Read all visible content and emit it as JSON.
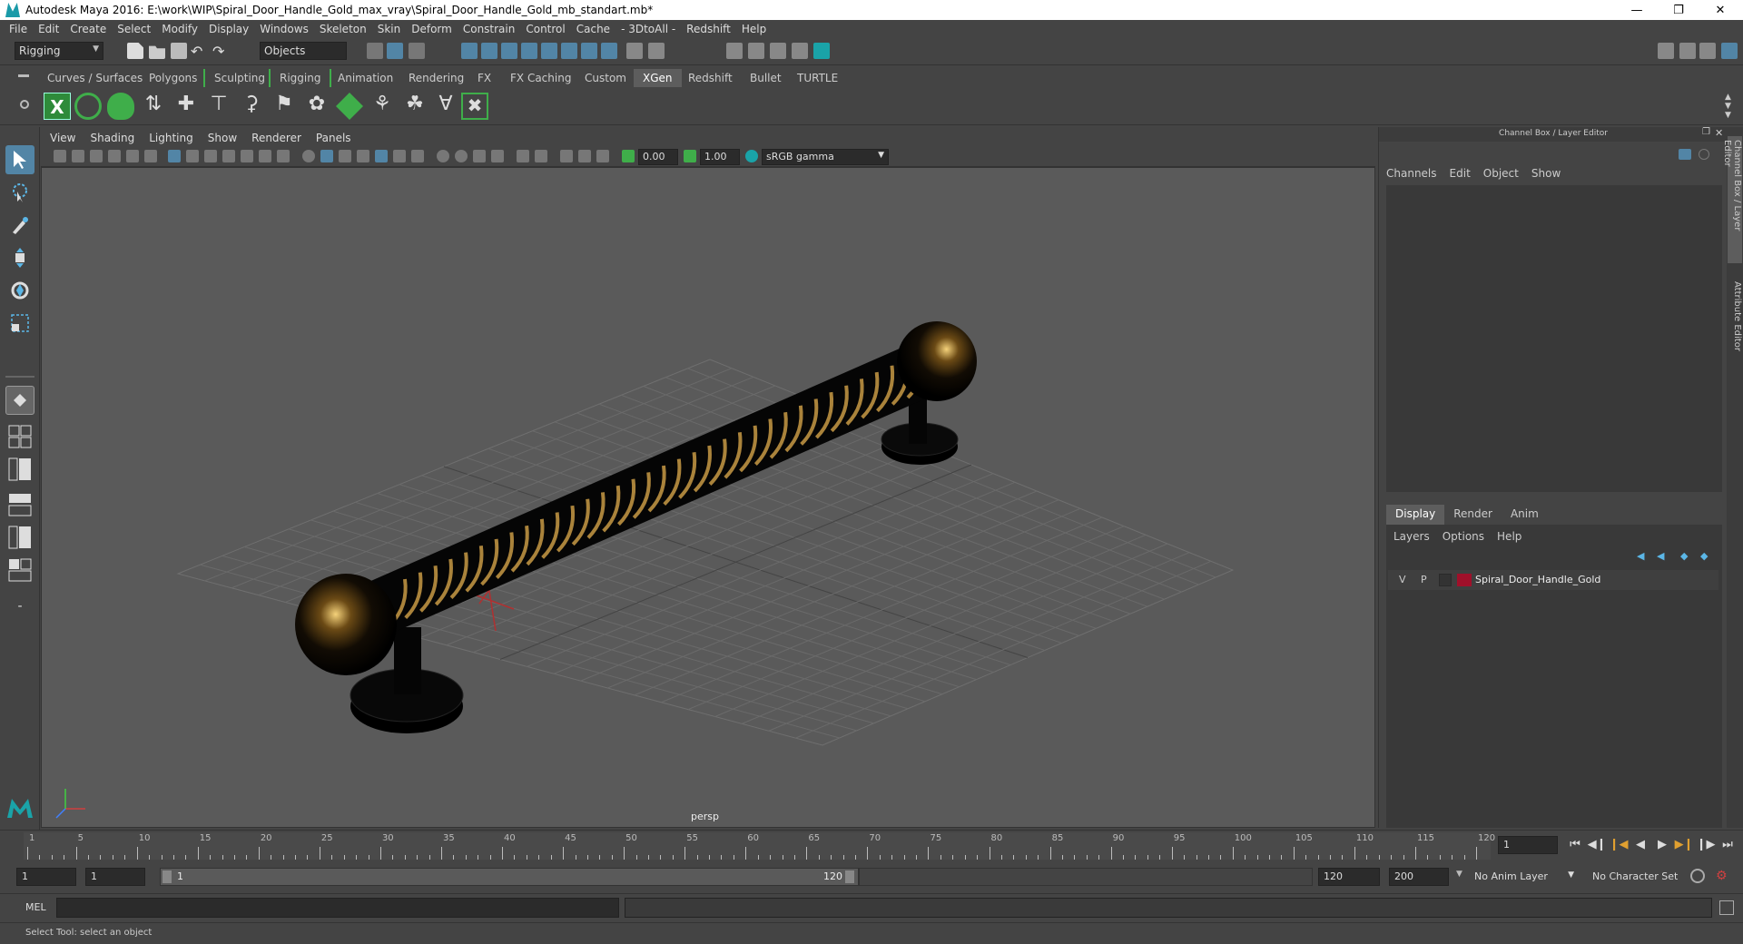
{
  "window": {
    "title": "Autodesk Maya 2016: E:\\work\\WIP\\Spiral_Door_Handle_Gold_max_vray\\Spiral_Door_Handle_Gold_mb_standart.mb*"
  },
  "menubar": [
    "File",
    "Edit",
    "Create",
    "Select",
    "Modify",
    "Display",
    "Windows",
    "Skeleton",
    "Skin",
    "Deform",
    "Constrain",
    "Control",
    "Cache",
    "- 3DtoAll -",
    "Redshift",
    "Help"
  ],
  "statusline": {
    "mode": "Rigging",
    "selection_mode": "Objects"
  },
  "shelf_tabs": [
    "Curves / Surfaces",
    "Polygons",
    "Sculpting",
    "Rigging",
    "Animation",
    "Rendering",
    "FX",
    "FX Caching",
    "Custom",
    "XGen",
    "Redshift",
    "Bullet",
    "TURTLE"
  ],
  "active_shelf_tab": "XGen",
  "viewport": {
    "menu": [
      "View",
      "Shading",
      "Lighting",
      "Show",
      "Renderer",
      "Panels"
    ],
    "exposure": "0.00",
    "gamma": "1.00",
    "color_space": "sRGB gamma",
    "camera_label": "persp"
  },
  "channel_box": {
    "title": "Channel Box / Layer Editor",
    "menu": [
      "Channels",
      "Edit",
      "Object",
      "Show"
    ]
  },
  "layer_editor": {
    "tabs": [
      "Display",
      "Render",
      "Anim"
    ],
    "active_tab": "Display",
    "menu": [
      "Layers",
      "Options",
      "Help"
    ],
    "layers": [
      {
        "v": "V",
        "p": "P",
        "name": "Spiral_Door_Handle_Gold",
        "color": "#a0102a"
      }
    ]
  },
  "side_tabs": [
    "Channel Box / Layer Editor",
    "Attribute Editor"
  ],
  "timeline": {
    "ticks": [
      "1",
      "5",
      "10",
      "15",
      "20",
      "25",
      "30",
      "35",
      "40",
      "45",
      "50",
      "55",
      "60",
      "65",
      "70",
      "75",
      "80",
      "85",
      "90",
      "95",
      "100",
      "105",
      "110",
      "115",
      "120"
    ],
    "current_frame": "1"
  },
  "range": {
    "start": "1",
    "anim_start": "1",
    "slider_min": "1",
    "slider_max": "120",
    "anim_end": "120",
    "end": "200",
    "anim_layer": "No Anim Layer",
    "character_set": "No Character Set"
  },
  "command_line": {
    "label": "MEL"
  },
  "help_line": {
    "text": "Select Tool: select an object"
  },
  "colors": {
    "accent": "#5285a6",
    "background": "#444444",
    "viewport_bg": "#5a5a5a",
    "shelf_green": "#3fae4a"
  }
}
